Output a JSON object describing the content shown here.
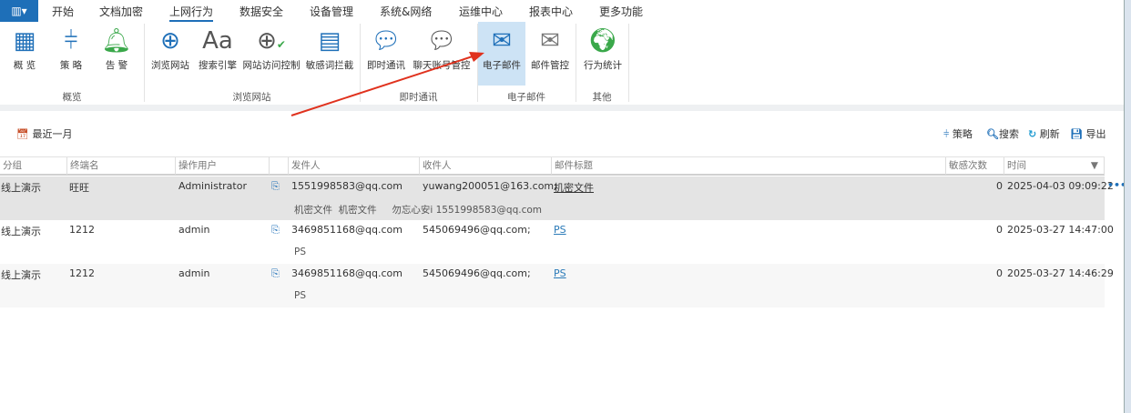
{
  "menu": {
    "items": [
      "开始",
      "文档加密",
      "上网行为",
      "数据安全",
      "设备管理",
      "系统&网络",
      "运维中心",
      "报表中心",
      "更多功能"
    ],
    "active": "上网行为"
  },
  "ribbon": {
    "buttons": [
      {
        "label": "概 览",
        "icon": "grid-icon"
      },
      {
        "label": "策 略",
        "icon": "sliders-icon"
      },
      {
        "label": "告 警",
        "icon": "bell-icon"
      },
      {
        "label": "浏览网站",
        "icon": "globe-icon"
      },
      {
        "label": "搜索引擎",
        "icon": "font-icon"
      },
      {
        "label": "网站访问控制",
        "icon": "globe-check-icon"
      },
      {
        "label": "敏感词拦截",
        "icon": "window-shield-icon"
      },
      {
        "label": "即时通讯",
        "icon": "chat-icon"
      },
      {
        "label": "聊天账号管控",
        "icon": "chat-user-icon"
      },
      {
        "label": "电子邮件",
        "icon": "mail-card-icon"
      },
      {
        "label": "邮件管控",
        "icon": "mail-shield-icon"
      },
      {
        "label": "行为统计",
        "icon": "globe-stats-icon"
      }
    ],
    "selected": "电子邮件",
    "groups": [
      "概览",
      "浏览网站",
      "即时通讯",
      "电子邮件",
      "其他"
    ]
  },
  "toolbar": {
    "range": "最近一月",
    "policy": "策略",
    "search": "搜索",
    "refresh": "刷新",
    "export": "导出"
  },
  "table": {
    "columns": [
      "分组",
      "终端名",
      "操作用户",
      "",
      "发件人",
      "收件人",
      "邮件标题",
      "敏感次数",
      "时间"
    ],
    "rows": [
      {
        "group": "线上演示",
        "terminal": "旺旺",
        "user": "Administrator",
        "sender": "1551998583@qq.com",
        "recipient": "yuwang200051@163.com;",
        "subject": "机密文件",
        "count": "0",
        "time": "2025-04-03 09:09:22",
        "detail": "机密文件  机密文件     勿忘心安i 1551998583@qq.com",
        "selected": true
      },
      {
        "group": "线上演示",
        "terminal": "1212",
        "user": "admin",
        "sender": "3469851168@qq.com",
        "recipient": "545069496@qq.com;",
        "subject": "PS",
        "count": "0",
        "time": "2025-03-27 14:47:00",
        "detail": "PS"
      },
      {
        "group": "线上演示",
        "terminal": "1212",
        "user": "admin",
        "sender": "3469851168@qq.com",
        "recipient": "545069496@qq.com;",
        "subject": "PS",
        "count": "0",
        "time": "2025-03-27 14:46:29",
        "detail": "PS"
      }
    ]
  },
  "colors": {
    "accent": "#1e6fb8",
    "selected_ribbon": "#cde3f5",
    "selected_row": "#e4e4e4",
    "arrow": "#e0321e"
  }
}
